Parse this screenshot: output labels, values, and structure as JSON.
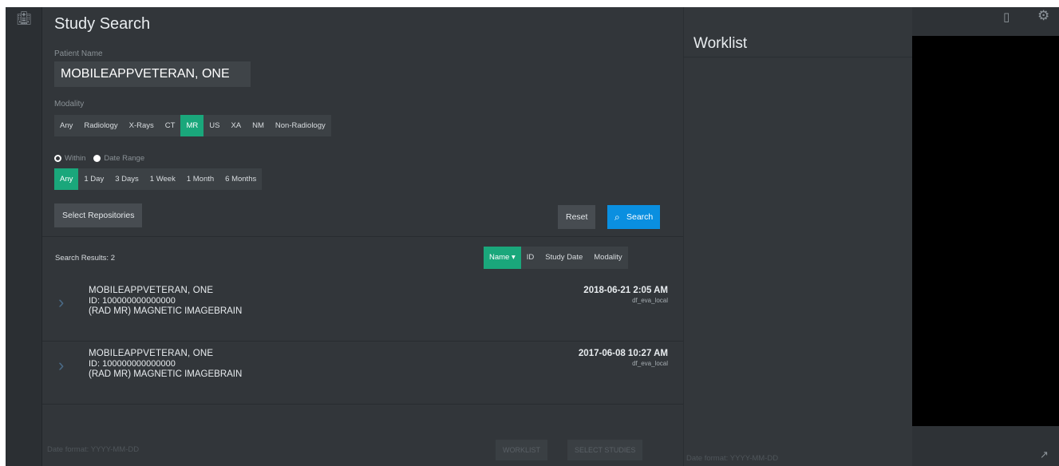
{
  "rail": {
    "logo_icon": "hospital-icon"
  },
  "search": {
    "title": "Study Search",
    "patient_label": "Patient Name",
    "patient_value": "MOBILEAPPVETERAN, ONE",
    "modality_label": "Modality",
    "modalities": [
      "Any",
      "Radiology",
      "X-Rays",
      "CT",
      "MR",
      "US",
      "XA",
      "NM",
      "Non-Radiology"
    ],
    "modality_selected": "MR",
    "radio_within": "Within",
    "radio_range": "Date Range",
    "ranges": [
      "Any",
      "1 Day",
      "3 Days",
      "1 Week",
      "1 Month",
      "6 Months"
    ],
    "range_selected": "Any",
    "select_repos_label": "Select Repositories",
    "reset_label": "Reset",
    "search_label": "Search",
    "results_label": "Search Results: 2",
    "sort_options": [
      "Name",
      "ID",
      "Study Date",
      "Modality"
    ],
    "sort_selected": "Name",
    "results": [
      {
        "name": "MOBILEAPPVETERAN, ONE",
        "id": "ID: 100000000000000",
        "desc": "(RAD MR) MAGNETIC IMAGEBRAIN",
        "date": "2018-06-21  2:05 AM",
        "repo": "df_eva_local"
      },
      {
        "name": "MOBILEAPPVETERAN, ONE",
        "id": "ID: 100000000000000",
        "desc": "(RAD MR) MAGNETIC IMAGEBRAIN",
        "date": "2017-06-08  10:27 AM",
        "repo": "df_eva_local"
      }
    ],
    "footer_date_format": "Date format: YYYY-MM-DD",
    "footer_btn1": "WORKLIST",
    "footer_btn2": "SELECT STUDIES"
  },
  "worklist": {
    "title": "Worklist",
    "footer_date_format": "Date format: YYYY-MM-DD"
  },
  "colors": {
    "accent": "#1aa77b",
    "primary": "#0a8fe0",
    "panel": "#32363a"
  }
}
